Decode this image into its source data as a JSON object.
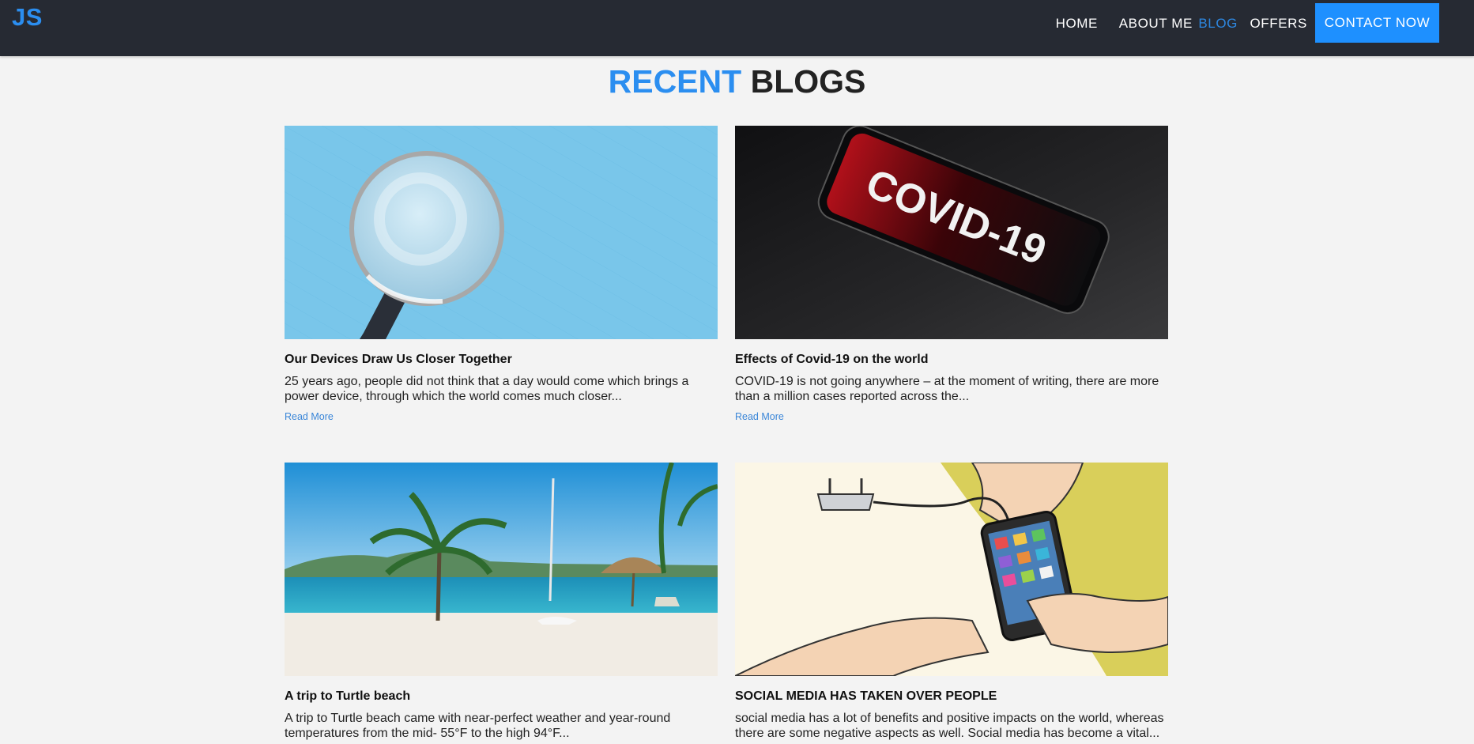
{
  "nav": {
    "logo": "JS",
    "links": [
      "HOME",
      "ABOUT ME",
      "BLOG",
      "OFFERS"
    ],
    "active": "BLOG",
    "contact": "CONTACT NOW"
  },
  "title": {
    "accent": "RECENT",
    "rest": "BLOGS"
  },
  "posts": [
    {
      "title": "Our Devices Draw Us Closer Together",
      "excerpt": "25 years ago, people did not think that a day would come which brings a power device, through which the world comes much closer...",
      "link": "Read More"
    },
    {
      "title": "Effects of Covid-19 on the world",
      "excerpt": "COVID-19 is not going anywhere – at the moment of writing, there are more than a million cases reported across the...",
      "link": "Read More",
      "image_text": "COVID-19"
    },
    {
      "title": "A trip to Turtle beach",
      "excerpt": "A trip to Turtle beach came with near-perfect weather and year-round temperatures from the mid- 55°F to the high 94°F..."
    },
    {
      "title": "SOCIAL MEDIA HAS TAKEN OVER PEOPLE",
      "excerpt": "social media has a lot of benefits and positive impacts on the world, whereas there are some negative aspects as well. Social media has become a vital..."
    }
  ],
  "colors": {
    "navbar": "#262a33",
    "accent": "#1e90ff",
    "page_bg": "#f3f3f3"
  }
}
